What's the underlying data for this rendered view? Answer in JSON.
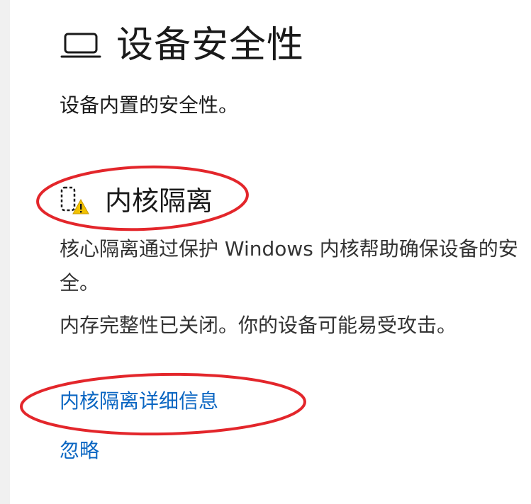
{
  "header": {
    "icon": "laptop-icon",
    "title": "设备安全性",
    "subtitle": "设备内置的安全性。"
  },
  "core_isolation": {
    "icon": "core-isolation-warning-icon",
    "title": "内核隔离",
    "description": "核心隔离通过保护 Windows 内核帮助确保设备的安全。",
    "status": "内存完整性已关闭。你的设备可能易受攻击。",
    "details_link": "内核隔离详细信息",
    "ignore_link": "忽略"
  },
  "colors": {
    "link": "#0a66c2",
    "warning": "#f2c200",
    "annotation": "#e3262b"
  }
}
